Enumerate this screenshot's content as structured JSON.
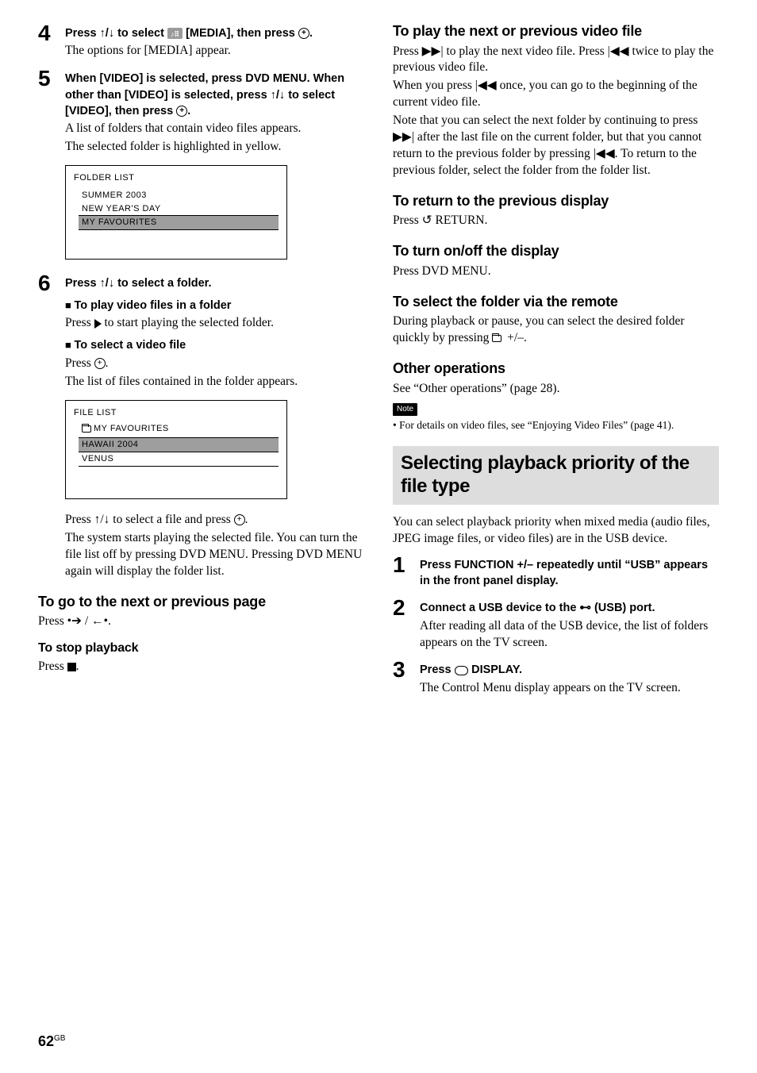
{
  "left": {
    "step4": {
      "num": "4",
      "line1_a": "Press ",
      "line1_b": "/",
      "line1_c": " to select ",
      "line1_media_label": "♪⠿",
      "line1_d": " [MEDIA], then press ",
      "line1_e": ".",
      "body": "The options for [MEDIA] appear."
    },
    "step5": {
      "num": "5",
      "instr": "When [VIDEO] is selected, press DVD MENU. When other than [VIDEO] is selected, press ↑/↓ to select [VIDEO], then press ",
      "instr_end": ".",
      "body1": "A list of folders that contain video files appears.",
      "body2": "The selected folder is highlighted in yellow."
    },
    "screen1": {
      "title": "FOLDER LIST",
      "items": [
        "SUMMER 2003",
        "NEW YEAR'S DAY",
        "MY FAVOURITES"
      ]
    },
    "step6": {
      "num": "6",
      "instr": "Press ↑/↓ to select a folder.",
      "sub1_h": "To play video files in a folder",
      "sub1_b_a": "Press ",
      "sub1_b_b": " to start playing the selected folder.",
      "sub2_h": "To select a video file",
      "sub2_b_a": "Press ",
      "sub2_b_b": ".",
      "sub2_b2": "The list of files contained in the folder appears."
    },
    "screen2": {
      "title": "FILE LIST",
      "folder": "MY FAVOURITES",
      "items": [
        "HAWAII 2004",
        "VENUS"
      ]
    },
    "after_screen2_a": "Press ",
    "after_screen2_b": "/",
    "after_screen2_c": " to select a file and press ",
    "after_screen2_d": ".",
    "after_screen2_p2": "The system starts playing the selected file. You can turn the file list off by pressing DVD MENU. Pressing DVD MENU again will display the folder list.",
    "h2_next": "To go to the next or previous page",
    "next_body_a": "Press ",
    "next_body_b": " / ",
    "next_body_c": ".",
    "h3_stop": "To stop playback",
    "stop_body_a": "Press ",
    "stop_body_b": "."
  },
  "right": {
    "h2_play": "To play the next or previous video file",
    "play_p1_a": "Press ",
    "play_p1_b": " to play the next video file. Press ",
    "play_p1_c": " twice to play the previous video file.",
    "play_p2_a": "When you press ",
    "play_p2_b": " once, you can go to the beginning of the current video file.",
    "play_p3_a": "Note that you can select the next folder by continuing to press ",
    "play_p3_b": " after the last file on the current folder, but that you cannot return to the previous folder by pressing ",
    "play_p3_c": ". To return to the previous folder, select the folder from the folder list.",
    "h2_return": "To return to the previous display",
    "return_body_a": "Press ",
    "return_body_b": " RETURN.",
    "h2_onoff": "To turn on/off the display",
    "onoff_body": "Press DVD MENU.",
    "h2_select_folder": "To select the folder via the remote",
    "select_folder_body_a": "During playback or pause, you can select the desired folder quickly by pressing ",
    "select_folder_body_b": " +/–.",
    "h2_other": "Other operations",
    "other_body": "See “Other operations” (page 28).",
    "note_label": "Note",
    "note_text": "For details on video files, see “Enjoying Video Files” (page 41).",
    "section_title": "Selecting playback priority of the file type",
    "section_intro": "You can select playback priority when mixed media (audio files, JPEG image files, or video files) are in the USB device.",
    "rstep1": {
      "num": "1",
      "instr": "Press FUNCTION +/– repeatedly until “USB” appears in the front panel display."
    },
    "rstep2": {
      "num": "2",
      "instr_a": "Connect a USB device to the ",
      "instr_b": " (USB) port.",
      "body": "After reading all data of the USB device, the list of folders appears on the TV screen."
    },
    "rstep3": {
      "num": "3",
      "instr_a": "Press ",
      "instr_b": " DISPLAY.",
      "body": "The Control Menu display appears on the TV screen."
    }
  },
  "footer": {
    "page": "62",
    "region": "GB"
  },
  "glyphs": {
    "up": "↑",
    "down": "↓",
    "next": "▶▶|",
    "prev": "|◀◀",
    "dot_right": "•➔",
    "dot_left": "←•",
    "return_icon": "♂⤴",
    "usb": "⊷"
  }
}
